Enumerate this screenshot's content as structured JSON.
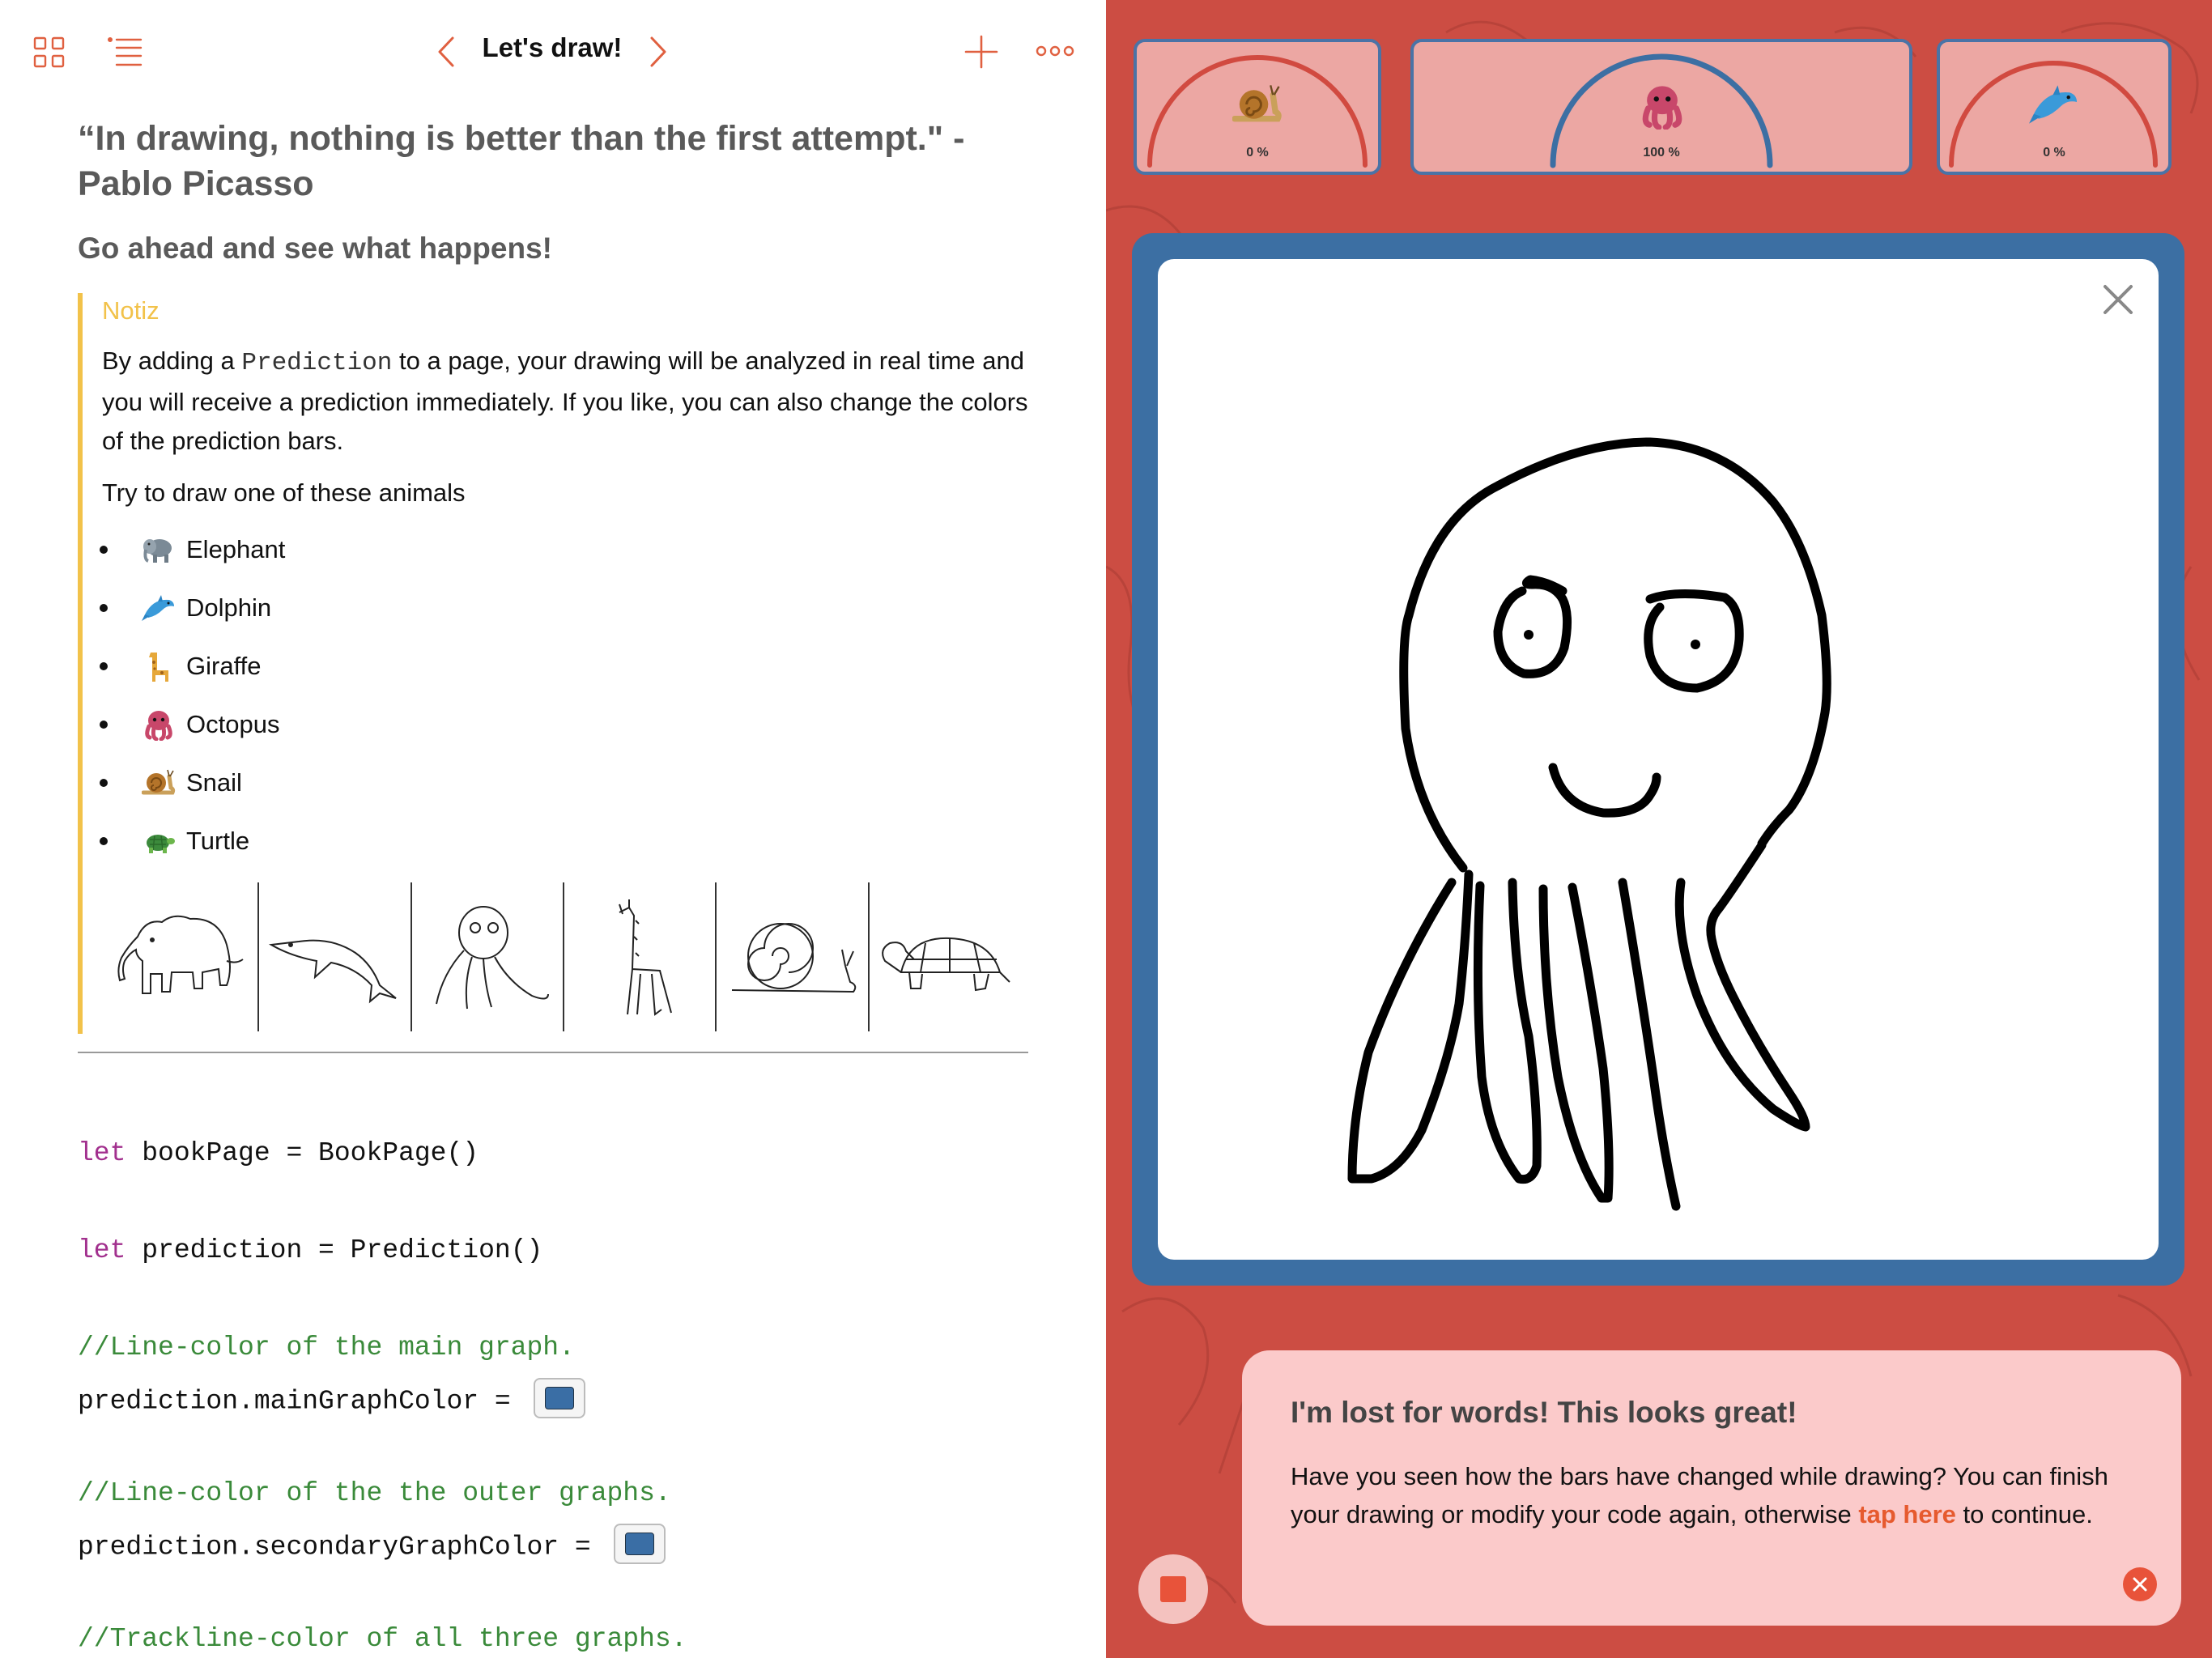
{
  "nav": {
    "title": "Let's draw!",
    "accent": "#e06040"
  },
  "content": {
    "quote": "“In drawing, nothing is better than the first attempt.\" - Pablo Picasso",
    "subheading": "Go ahead and see what happens!",
    "note": {
      "title": "Notiz",
      "body_before": "By adding a ",
      "body_code": "Prediction",
      "body_after": " to a page, your drawing will be analyzed in real time and you will receive a prediction immediately. If you like, you can also change the colors of the prediction bars.",
      "try_text": "Try to draw one of these animals",
      "animals": [
        {
          "name": "Elephant",
          "icon": "elephant-icon"
        },
        {
          "name": "Dolphin",
          "icon": "dolphin-icon"
        },
        {
          "name": "Giraffe",
          "icon": "giraffe-icon"
        },
        {
          "name": "Octopus",
          "icon": "octopus-icon"
        },
        {
          "name": "Snail",
          "icon": "snail-icon"
        },
        {
          "name": "Turtle",
          "icon": "turtle-icon"
        }
      ]
    }
  },
  "code": {
    "line1_kw": "let",
    "line1_rest": " bookPage = BookPage()",
    "line2_kw": "let",
    "line2_rest": " prediction = Prediction()",
    "comment1": "//Line-color of the main graph.",
    "line3": "prediction.mainGraphColor = ",
    "comment2": "//Line-color of the the outer graphs.",
    "line4": "prediction.secondaryGraphColor = ",
    "comment3": "//Trackline-color of all three graphs.",
    "main_graph_color": "#3a6ea5",
    "secondary_graph_color": "#3a6ea5"
  },
  "predictions": {
    "left": {
      "icon": "snail-icon",
      "percent_label": "0 %",
      "value": 0,
      "color": "#d14a40"
    },
    "center": {
      "icon": "octopus-icon",
      "percent_label": "100 %",
      "value": 100,
      "color": "#3c6fa3"
    },
    "right": {
      "icon": "dolphin-icon",
      "percent_label": "0 %",
      "value": 0,
      "color": "#d14a40"
    }
  },
  "hint": {
    "title": "I'm lost for words! This looks great!",
    "text_before": "Have you seen how the bars have changed while drawing? You can finish your drawing or modify your code again, otherwise ",
    "link": "tap here",
    "text_after": " to continue."
  }
}
